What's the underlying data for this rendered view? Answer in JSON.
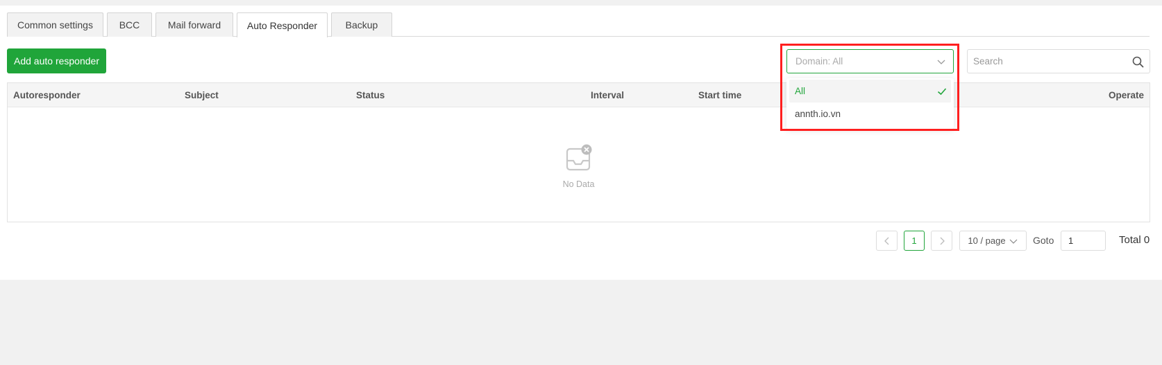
{
  "tabs": [
    {
      "label": "Common settings",
      "active": false
    },
    {
      "label": "BCC",
      "active": false
    },
    {
      "label": "Mail forward",
      "active": false
    },
    {
      "label": "Auto Responder",
      "active": true
    },
    {
      "label": "Backup",
      "active": false
    }
  ],
  "toolbar": {
    "add_label": "Add auto responder",
    "domain_select_label": "Domain: All",
    "search_placeholder": "Search"
  },
  "dropdown": {
    "options": [
      {
        "label": "All",
        "selected": true
      },
      {
        "label": "annth.io.vn",
        "selected": false
      }
    ]
  },
  "table": {
    "columns": [
      "Autoresponder",
      "Subject",
      "Status",
      "Interval",
      "Start time",
      "Operate"
    ],
    "empty_text": "No Data"
  },
  "pagination": {
    "prev_icon": "chevron-left-icon",
    "current_page": "1",
    "next_icon": "chevron-right-icon",
    "page_size": "10 / page",
    "goto_label": "Goto",
    "goto_value": "1",
    "total": "Total 0"
  },
  "colors": {
    "accent": "#20a53a",
    "highlight": "#ff1f1f"
  }
}
